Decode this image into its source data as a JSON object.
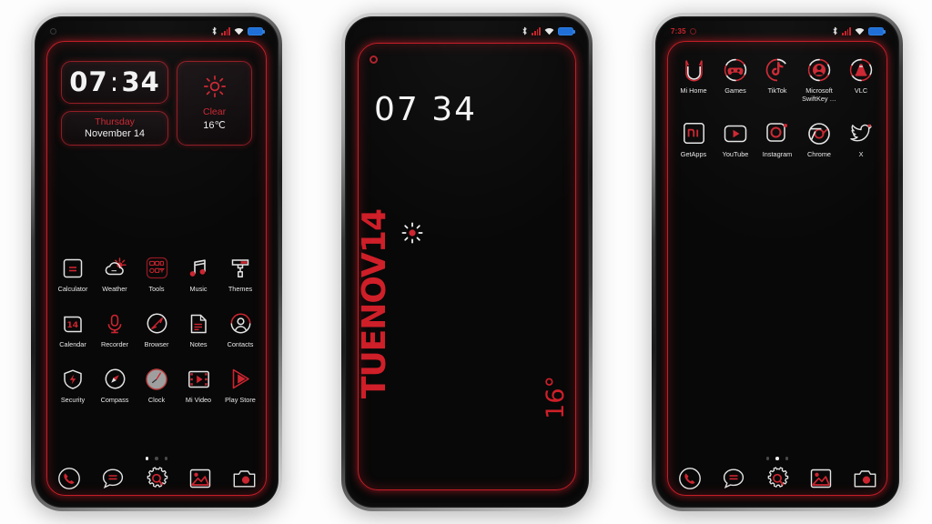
{
  "theme": {
    "accent_red": "#c41e28",
    "text_white": "#efefef",
    "background": "#080808",
    "battery_blue": "#2f7fe0"
  },
  "phones": [
    {
      "id": "phone-home-page1",
      "type": "home",
      "status_bar": {
        "time": "",
        "icons": [
          "bluetooth-icon",
          "signal-icon",
          "wifi-icon",
          "battery-icon"
        ]
      },
      "widgets": {
        "clock": {
          "hours": "07",
          "separator": ":",
          "minutes": "34"
        },
        "date": {
          "weekday": "Thursday",
          "date": "November 14"
        },
        "weather": {
          "icon": "sun-icon",
          "condition": "Clear",
          "temperature": "16℃"
        }
      },
      "apps": [
        [
          {
            "label": "Calculator",
            "icon": "calculator-icon"
          },
          {
            "label": "Weather",
            "icon": "weather-cloud-sun-icon"
          },
          {
            "label": "Tools",
            "icon": "tools-folder-icon"
          },
          {
            "label": "Music",
            "icon": "music-note-icon"
          },
          {
            "label": "Themes",
            "icon": "themes-brush-icon"
          }
        ],
        [
          {
            "label": "Calendar",
            "icon": "calendar-14-icon"
          },
          {
            "label": "Recorder",
            "icon": "microphone-icon"
          },
          {
            "label": "Browser",
            "icon": "compass-browser-icon"
          },
          {
            "label": "Notes",
            "icon": "notes-page-icon"
          },
          {
            "label": "Contacts",
            "icon": "contacts-person-icon"
          }
        ],
        [
          {
            "label": "Security",
            "icon": "shield-bolt-icon"
          },
          {
            "label": "Compass",
            "icon": "compass-needle-icon"
          },
          {
            "label": "Clock",
            "icon": "analog-clock-icon"
          },
          {
            "label": "Mi Video",
            "icon": "film-play-icon"
          },
          {
            "label": "Play Store",
            "icon": "play-triangle-icon"
          }
        ]
      ],
      "page_dots": {
        "count": 3,
        "active": 0
      },
      "dock": [
        {
          "label": "Phone",
          "icon": "phone-handset-icon"
        },
        {
          "label": "Messages",
          "icon": "message-bubble-icon"
        },
        {
          "label": "Settings",
          "icon": "gear-search-icon"
        },
        {
          "label": "Gallery",
          "icon": "photo-mountain-icon"
        },
        {
          "label": "Camera",
          "icon": "camera-icon"
        }
      ]
    },
    {
      "id": "phone-lockscreen",
      "type": "lock",
      "status_bar": {
        "time": "",
        "icons": [
          "bluetooth-icon",
          "signal-icon",
          "wifi-icon",
          "battery-icon"
        ]
      },
      "lock": {
        "time": "07 34",
        "date_vertical": "TUENOV14",
        "weather_icon": "sun-icon",
        "temperature": "16°"
      }
    },
    {
      "id": "phone-home-page2",
      "type": "home",
      "status_bar": {
        "time": "7:35",
        "icons": [
          "bluetooth-icon",
          "signal-icon",
          "wifi-icon",
          "battery-icon"
        ]
      },
      "apps": [
        [
          {
            "label": "Mi Home",
            "icon": "mi-home-icon"
          },
          {
            "label": "Games",
            "icon": "games-controller-icon"
          },
          {
            "label": "TikTok",
            "icon": "tiktok-icon"
          },
          {
            "label": "Microsoft SwiftKey …",
            "icon": "swiftkey-icon"
          },
          {
            "label": "VLC",
            "icon": "vlc-cone-icon"
          }
        ],
        [
          {
            "label": "GetApps",
            "icon": "getapps-mi-icon"
          },
          {
            "label": "YouTube",
            "icon": "youtube-icon"
          },
          {
            "label": "Instagram",
            "icon": "instagram-icon"
          },
          {
            "label": "Chrome",
            "icon": "chrome-icon"
          },
          {
            "label": "X",
            "icon": "x-twitter-icon"
          }
        ]
      ],
      "page_dots": {
        "count": 3,
        "active": 1
      },
      "dock": [
        {
          "label": "Phone",
          "icon": "phone-handset-icon"
        },
        {
          "label": "Messages",
          "icon": "message-bubble-icon"
        },
        {
          "label": "Settings",
          "icon": "gear-search-icon"
        },
        {
          "label": "Gallery",
          "icon": "photo-mountain-icon"
        },
        {
          "label": "Camera",
          "icon": "camera-icon"
        }
      ]
    }
  ]
}
